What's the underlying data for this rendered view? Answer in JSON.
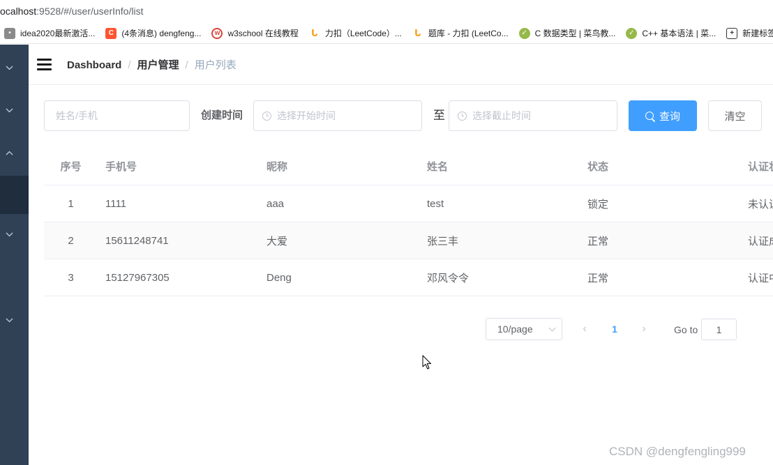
{
  "browser": {
    "url_host": "ocalhost",
    "url_rest": ":9528/#/user/userInfo/list",
    "bookmarks": [
      {
        "icon": "generic-icon",
        "fav": "•",
        "label": "idea2020最新激活..."
      },
      {
        "icon": "csdn-icon",
        "fav": "C",
        "label": "(4条消息) dengfeng..."
      },
      {
        "icon": "w3school-icon",
        "fav": "w",
        "label": "w3school 在线教程"
      },
      {
        "icon": "leetcode-icon",
        "fav": "ᒐ",
        "label": "力扣（LeetCode）..."
      },
      {
        "icon": "leetcode-icon",
        "fav": "ᒐ",
        "label": "题库 - 力扣 (LeetCo..."
      },
      {
        "icon": "runoob-icon",
        "fav": "✓",
        "label": "C 数据类型 | 菜鸟教..."
      },
      {
        "icon": "runoob-icon",
        "fav": "✓",
        "label": "C++ 基本语法 | 菜..."
      },
      {
        "icon": "new-tab-icon",
        "fav": "+",
        "label": "新建标签"
      }
    ]
  },
  "navbar": {
    "breadcrumb": [
      "Dashboard",
      "用户管理",
      "用户列表"
    ],
    "separator": "/"
  },
  "filters": {
    "name_placeholder": "姓名/手机",
    "created_label": "创建时间",
    "start_placeholder": "选择开始时间",
    "to_label": "至",
    "end_placeholder": "选择截止时间",
    "search_button": "查询",
    "clear_button": "清空"
  },
  "table": {
    "columns": [
      "序号",
      "手机号",
      "昵称",
      "姓名",
      "状态",
      "认证状"
    ],
    "rows": [
      [
        "1",
        "1111",
        "aaa",
        "test",
        "锁定",
        "未认证"
      ],
      [
        "2",
        "15611248741",
        "大爱",
        "张三丰",
        "正常",
        "认证成"
      ],
      [
        "3",
        "15127967305",
        "Deng",
        "邓风令令",
        "正常",
        "认证中"
      ]
    ]
  },
  "pagination": {
    "page_size": "10/page",
    "prev": "‹",
    "current_page": "1",
    "next": "›",
    "goto_label": "Go to",
    "goto_value": "1"
  },
  "watermark": "CSDN @dengfengling999",
  "colors": {
    "sidebar": "#304156",
    "primary": "#409eff"
  }
}
